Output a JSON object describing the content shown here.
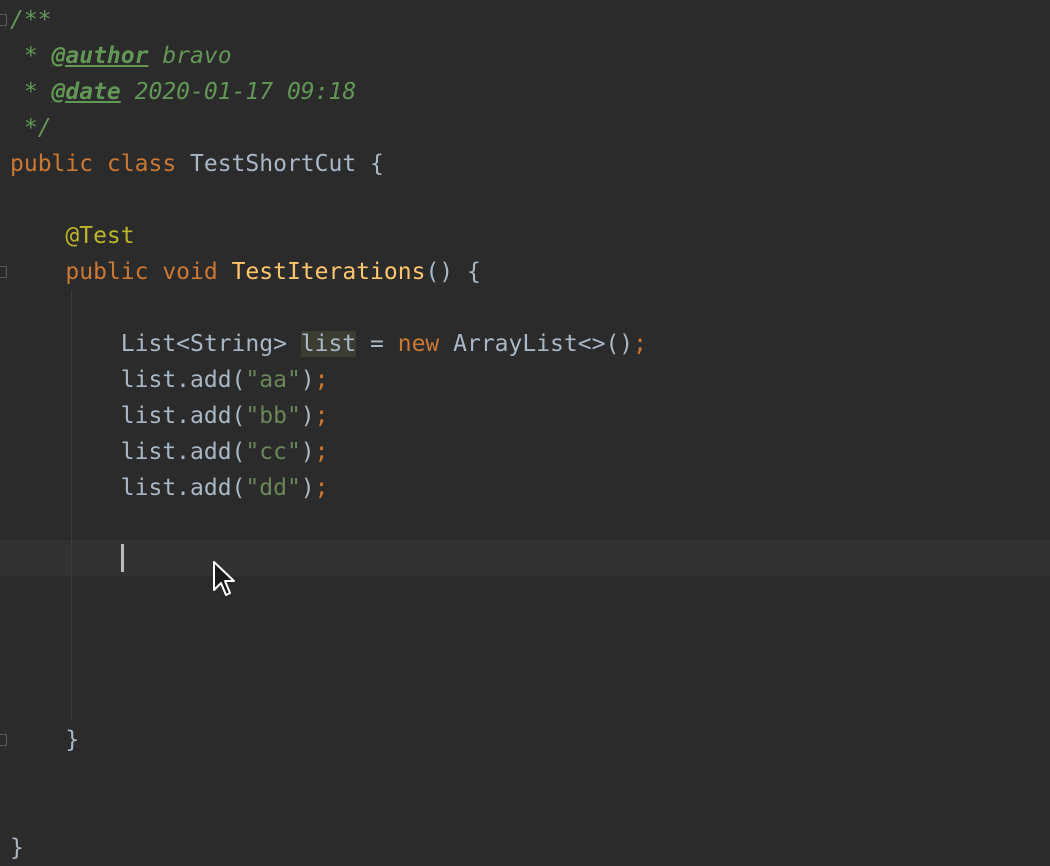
{
  "editor": {
    "language": "java",
    "lines": [
      {
        "tokens": [
          {
            "t": "/**",
            "c": "doc"
          }
        ]
      },
      {
        "tokens": [
          {
            "t": " * ",
            "c": "doc"
          },
          {
            "t": "@author",
            "c": "doctag"
          },
          {
            "t": " bravo",
            "c": "doc"
          }
        ]
      },
      {
        "tokens": [
          {
            "t": " * ",
            "c": "doc"
          },
          {
            "t": "@date",
            "c": "doctag"
          },
          {
            "t": " 2020-01-17 09:18",
            "c": "doc"
          }
        ]
      },
      {
        "tokens": [
          {
            "t": " */",
            "c": "doc"
          }
        ]
      },
      {
        "tokens": [
          {
            "t": "public class ",
            "c": "kw"
          },
          {
            "t": "TestShortCut {",
            "c": "plain"
          }
        ]
      },
      {
        "tokens": []
      },
      {
        "tokens": [
          {
            "t": "    ",
            "c": "plain"
          },
          {
            "t": "@Test",
            "c": "anno"
          }
        ]
      },
      {
        "tokens": [
          {
            "t": "    ",
            "c": "plain"
          },
          {
            "t": "public void ",
            "c": "kw"
          },
          {
            "t": "TestIterations",
            "c": "fn"
          },
          {
            "t": "() {",
            "c": "plain"
          }
        ]
      },
      {
        "tokens": []
      },
      {
        "tokens": [
          {
            "t": "        List<String> ",
            "c": "plain"
          },
          {
            "t": "list",
            "c": "hl-var"
          },
          {
            "t": " = ",
            "c": "plain"
          },
          {
            "t": "new ",
            "c": "kw"
          },
          {
            "t": "ArrayList<>()",
            "c": "plain"
          },
          {
            "t": ";",
            "c": "semi"
          }
        ]
      },
      {
        "tokens": [
          {
            "t": "        list.add(",
            "c": "plain"
          },
          {
            "t": "\"aa\"",
            "c": "str"
          },
          {
            "t": ")",
            "c": "plain"
          },
          {
            "t": ";",
            "c": "semi"
          }
        ]
      },
      {
        "tokens": [
          {
            "t": "        list.add(",
            "c": "plain"
          },
          {
            "t": "\"bb\"",
            "c": "str"
          },
          {
            "t": ")",
            "c": "plain"
          },
          {
            "t": ";",
            "c": "semi"
          }
        ]
      },
      {
        "tokens": [
          {
            "t": "        list.add(",
            "c": "plain"
          },
          {
            "t": "\"cc\"",
            "c": "str"
          },
          {
            "t": ")",
            "c": "plain"
          },
          {
            "t": ";",
            "c": "semi"
          }
        ]
      },
      {
        "tokens": [
          {
            "t": "        list.add(",
            "c": "plain"
          },
          {
            "t": "\"dd\"",
            "c": "str"
          },
          {
            "t": ")",
            "c": "plain"
          },
          {
            "t": ";",
            "c": "semi"
          }
        ]
      },
      {
        "tokens": []
      },
      {
        "tokens": []
      },
      {
        "tokens": []
      },
      {
        "tokens": []
      },
      {
        "tokens": []
      },
      {
        "tokens": []
      },
      {
        "tokens": [
          {
            "t": "    }",
            "c": "plain"
          }
        ]
      },
      {
        "tokens": []
      },
      {
        "tokens": []
      },
      {
        "tokens": [
          {
            "t": "}",
            "c": "plain"
          }
        ]
      }
    ],
    "current_line_index": 15,
    "colors": {
      "background": "#2b2b2b",
      "keyword": "#cc7832",
      "string": "#6a8759",
      "annotation": "#bbb529",
      "function": "#ffc66d",
      "doc_comment": "#629755",
      "plain": "#a9b7c6"
    },
    "cursor_icon": "mouse-pointer-icon"
  }
}
